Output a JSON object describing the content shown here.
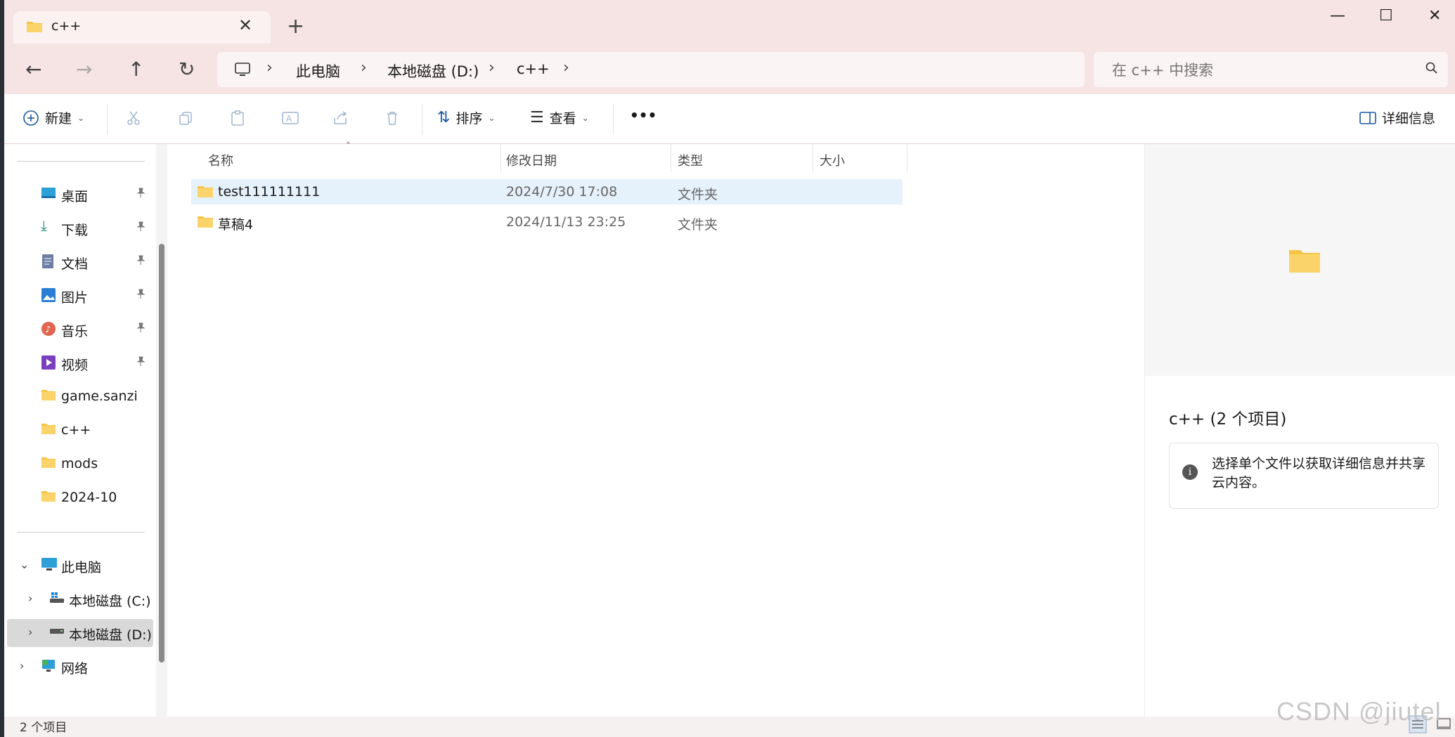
{
  "tab": {
    "title": "c++"
  },
  "address": {
    "crumbs": [
      "此电脑",
      "本地磁盘 (D:)",
      "c++"
    ]
  },
  "search": {
    "placeholder": "在 c++ 中搜索"
  },
  "toolbar": {
    "new_label": "新建",
    "sort_label": "排序",
    "view_label": "查看",
    "more_label": "•••",
    "details_label": "详细信息"
  },
  "sidebar": {
    "quick": [
      {
        "label": "桌面",
        "icon": "desktop-icon"
      },
      {
        "label": "下载",
        "icon": "download-icon"
      },
      {
        "label": "文档",
        "icon": "document-icon"
      },
      {
        "label": "图片",
        "icon": "pictures-icon"
      },
      {
        "label": "音乐",
        "icon": "music-icon"
      },
      {
        "label": "视频",
        "icon": "video-icon"
      },
      {
        "label": "game.sanzi",
        "icon": "folder-icon"
      },
      {
        "label": "c++",
        "icon": "folder-icon"
      },
      {
        "label": "mods",
        "icon": "folder-icon"
      },
      {
        "label": "2024-10",
        "icon": "folder-icon"
      }
    ],
    "this_pc": "此电脑",
    "drive_c": "本地磁盘 (C:)",
    "drive_d": "本地磁盘 (D:)",
    "network": "网络"
  },
  "columns": {
    "name": "名称",
    "date": "修改日期",
    "type": "类型",
    "size": "大小"
  },
  "files": [
    {
      "name": "test111111111",
      "date": "2024/7/30 17:08",
      "type": "文件夹",
      "size": ""
    },
    {
      "name": "草稿4",
      "date": "2024/11/13 23:25",
      "type": "文件夹",
      "size": ""
    }
  ],
  "details": {
    "title": "c++ (2 个项目)",
    "info": "选择单个文件以获取详细信息并共享云内容。"
  },
  "status": {
    "count": "2 个项目"
  },
  "watermark": "CSDN @jiutel",
  "colors": {
    "titlebar": "#f6e3e3",
    "selection": "#e5f1fb",
    "folder": "#f6c445"
  }
}
